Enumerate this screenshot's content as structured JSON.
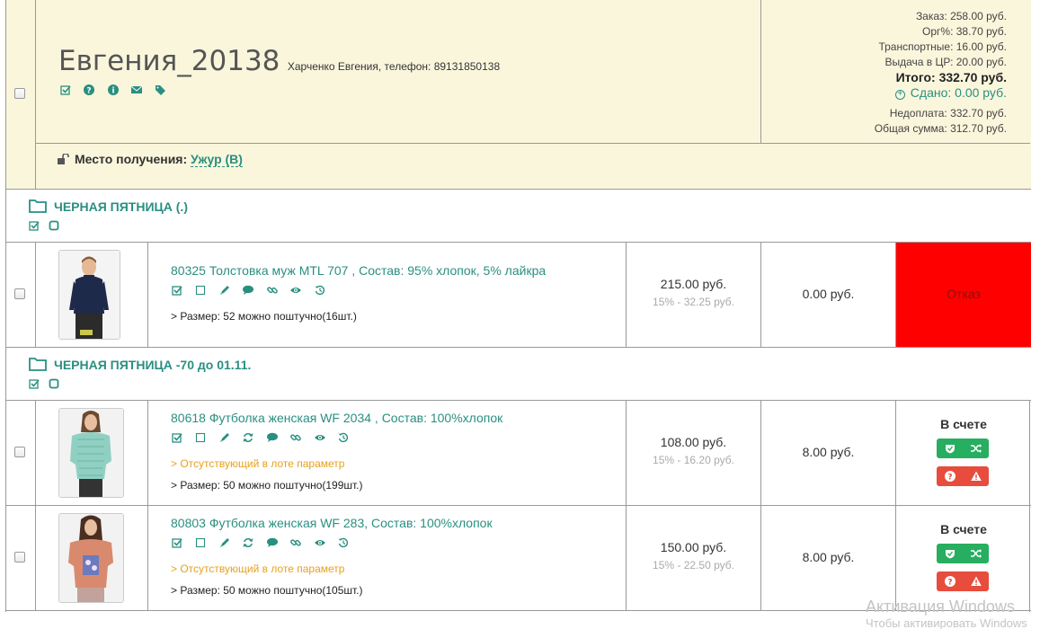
{
  "order": {
    "name": "Евгения_20138",
    "contact": "Харченко Евгения, телефон: 89131850138",
    "icons": [
      "check-square-icon",
      "question-circle-icon",
      "info-circle-icon",
      "envelope-icon",
      "tags-icon"
    ],
    "summary": {
      "zakaz": "Заказ: 258.00  руб.",
      "org": "Орг%: 38.70  руб.",
      "transport": "Транспортные: 16.00  руб.",
      "vydacha": "Выдача в ЦР: 20.00  руб.",
      "itogo": "Итого: 332.70  руб.",
      "sdano": "Сдано: 0.00  руб.",
      "nedoplata": "Недоплата: 332.70  руб.",
      "obshaya": "Общая сумма: 312.70  руб."
    },
    "pickup_label": "Место получения:",
    "pickup_value": "Ужур (В)"
  },
  "groups": [
    {
      "title": "ЧЕРНАЯ ПЯТНИЦА (.)",
      "items": [
        {
          "title": "80325 Толстовка муж MTL 707 , Состав: 95% хлопок, 5% лайкра",
          "warning": "",
          "size": "> Размер: 52 можно поштучно(16шт.)",
          "price": "215.00  руб.",
          "discount": "15% - 32.25  руб.",
          "extra": "0.00  руб.",
          "status": "Отказ"
        }
      ]
    },
    {
      "title": "ЧЕРНАЯ ПЯТНИЦА -70 до 01.11.",
      "items": [
        {
          "title": "80618 Футболка женская WF 2034 , Состав: 100%хлопок",
          "warning": "> Отсутствующий в лоте параметр",
          "size": "> Размер: 50 можно поштучно(199шт.)",
          "price": "108.00  руб.",
          "discount": "15% - 16.20  руб.",
          "extra": "8.00  руб.",
          "status": "В счете"
        },
        {
          "title": "80803 Футболка женская WF 283, Состав: 100%хлопок",
          "warning": "> Отсутствующий в лоте параметр",
          "size": "> Размер: 50 можно поштучно(105шт.)",
          "price": "150.00  руб.",
          "discount": "15% - 22.50  руб.",
          "extra": "8.00  руб.",
          "status": "В счете"
        }
      ]
    }
  ],
  "watermark": {
    "line1": "Активация Windows",
    "line2": "Чтобы активировать Windows"
  },
  "colors": {
    "header_bg": "#faf6dc",
    "accent": "#2a8f80",
    "refusal": "#ff0000",
    "btn_green": "#27ae60",
    "btn_red": "#e74c3c",
    "warning": "#e6a11e"
  }
}
